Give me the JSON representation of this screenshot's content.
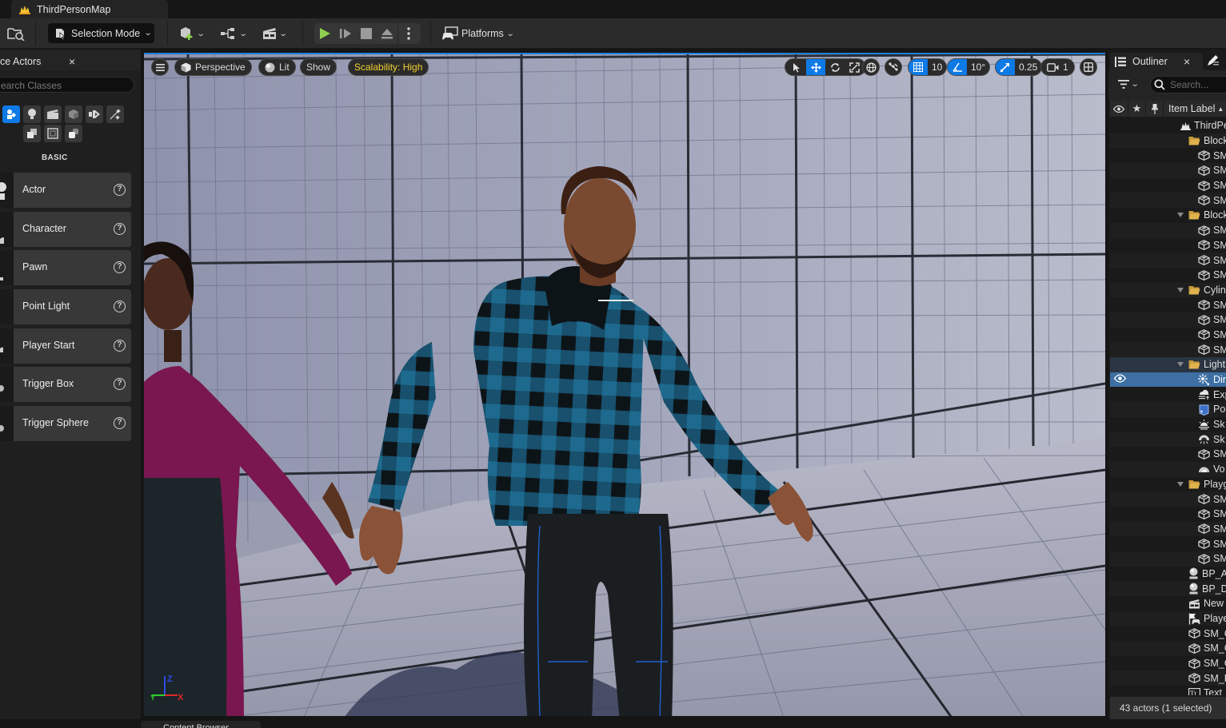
{
  "window": {
    "tab_title": "ThirdPersonMap"
  },
  "toolbar": {
    "selection_mode_label": "Selection Mode",
    "platforms_label": "Platforms",
    "play_color": "#8fd14f"
  },
  "place_actors": {
    "tab_label": "ce Actors",
    "close_glyph": "×",
    "search_placeholder": "earch Classes",
    "category_label": "BASIC",
    "items": [
      {
        "label": "Actor",
        "help": "?"
      },
      {
        "label": "Character",
        "help": "?"
      },
      {
        "label": "Pawn",
        "help": "?"
      },
      {
        "label": "Point Light",
        "help": "?"
      },
      {
        "label": "Player Start",
        "help": "?"
      },
      {
        "label": "Trigger Box",
        "help": "?"
      },
      {
        "label": "Trigger Sphere",
        "help": "?"
      }
    ]
  },
  "viewport": {
    "perspective_label": "Perspective",
    "lit_label": "Lit",
    "show_label": "Show",
    "scalability_label": "Scalability: High",
    "scalability_color": "#f2d22e",
    "grid_snap_value": "10",
    "rotation_snap_value": "10°",
    "scale_snap_value": "0.25",
    "camera_speed_value": "1",
    "accent_color": "#0e7ae6",
    "axis": {
      "z": "Z",
      "x": "X",
      "y": "Y"
    }
  },
  "outliner": {
    "tab_label": "Outliner",
    "close_glyph": "×",
    "search_placeholder": "Search...",
    "column_label": "Item Label",
    "sort_glyph": "▲",
    "rows": [
      {
        "label": "ThirdPe",
        "icon": "level-icon",
        "indent": 88
      },
      {
        "label": "Block",
        "icon": "folder-icon",
        "indent": 98,
        "arrow": false
      },
      {
        "label": "SM",
        "icon": "static-mesh-icon",
        "indent": 110
      },
      {
        "label": "SM",
        "icon": "static-mesh-icon",
        "indent": 110
      },
      {
        "label": "SM",
        "icon": "static-mesh-icon",
        "indent": 110
      },
      {
        "label": "SM",
        "icon": "static-mesh-icon",
        "indent": 110
      },
      {
        "label": "Block",
        "icon": "folder-icon",
        "indent": 98,
        "arrow": true
      },
      {
        "label": "SM",
        "icon": "static-mesh-icon",
        "indent": 110
      },
      {
        "label": "SM",
        "icon": "static-mesh-icon",
        "indent": 110
      },
      {
        "label": "SM",
        "icon": "static-mesh-icon",
        "indent": 110
      },
      {
        "label": "SM",
        "icon": "static-mesh-icon",
        "indent": 110
      },
      {
        "label": "Cylin",
        "icon": "folder-icon",
        "indent": 98,
        "arrow": true
      },
      {
        "label": "SM",
        "icon": "static-mesh-icon",
        "indent": 110
      },
      {
        "label": "SM",
        "icon": "static-mesh-icon",
        "indent": 110
      },
      {
        "label": "SM",
        "icon": "static-mesh-icon",
        "indent": 110
      },
      {
        "label": "SM",
        "icon": "static-mesh-icon",
        "indent": 110
      },
      {
        "label": "Light",
        "icon": "folder-icon",
        "indent": 98,
        "arrow": true,
        "state": "selfolder"
      },
      {
        "label": "Dir",
        "icon": "directional-light-icon",
        "indent": 110,
        "state": "sel"
      },
      {
        "label": "Exp",
        "icon": "height-fog-icon",
        "indent": 110
      },
      {
        "label": "Po",
        "icon": "post-process-icon",
        "indent": 110
      },
      {
        "label": "Sk",
        "icon": "sky-atmosphere-icon",
        "indent": 110
      },
      {
        "label": "Sk",
        "icon": "sky-light-icon",
        "indent": 110
      },
      {
        "label": "SM",
        "icon": "static-mesh-icon",
        "indent": 110
      },
      {
        "label": "Vo",
        "icon": "volumetric-cloud-icon",
        "indent": 110
      },
      {
        "label": "Playg",
        "icon": "folder-icon",
        "indent": 98,
        "arrow": true
      },
      {
        "label": "SM",
        "icon": "static-mesh-icon",
        "indent": 110
      },
      {
        "label": "SM",
        "icon": "static-mesh-icon",
        "indent": 110
      },
      {
        "label": "SM",
        "icon": "static-mesh-icon",
        "indent": 110
      },
      {
        "label": "SM",
        "icon": "static-mesh-icon",
        "indent": 110
      },
      {
        "label": "SM",
        "icon": "static-mesh-icon",
        "indent": 110
      },
      {
        "label": "BP_A",
        "icon": "blueprint-actor-icon",
        "indent": 98
      },
      {
        "label": "BP_D",
        "icon": "blueprint-actor-icon",
        "indent": 98
      },
      {
        "label": "New",
        "icon": "level-sequence-icon",
        "indent": 98
      },
      {
        "label": "Playe",
        "icon": "player-start-icon",
        "indent": 98
      },
      {
        "label": "SM_C",
        "icon": "static-mesh-icon",
        "indent": 98
      },
      {
        "label": "SM_C",
        "icon": "static-mesh-icon",
        "indent": 98
      },
      {
        "label": "SM_C",
        "icon": "static-mesh-icon",
        "indent": 98
      },
      {
        "label": "SM_F",
        "icon": "static-mesh-icon",
        "indent": 98
      },
      {
        "label": "Text",
        "icon": "text-render-icon",
        "indent": 98
      }
    ],
    "status": "43 actors (1 selected)"
  },
  "bottom": {
    "content_browser_label": "Content Browser"
  }
}
